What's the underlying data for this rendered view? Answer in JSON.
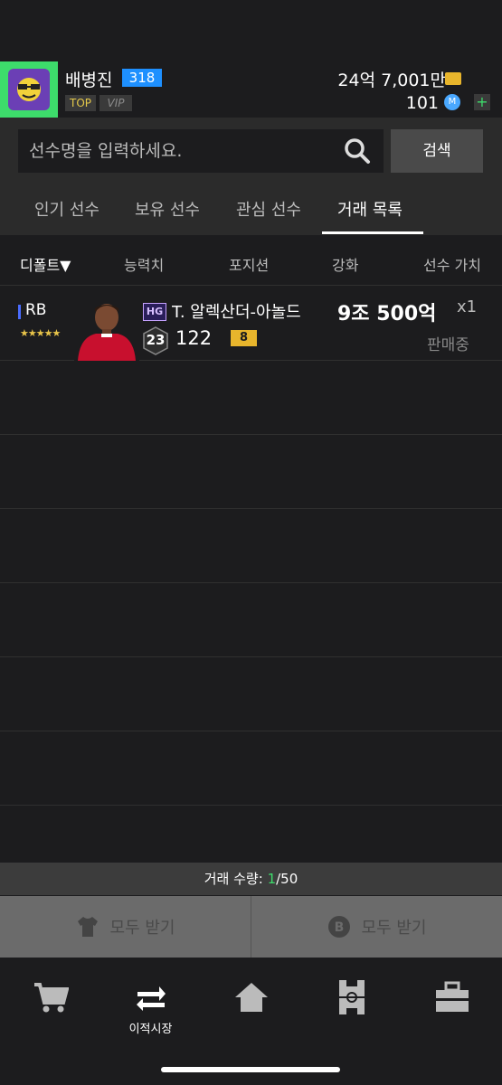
{
  "profile": {
    "username": "배병진",
    "level": "318",
    "top_badge": "TOP",
    "vip_badge": "VIP",
    "currency": "24억 7,001만",
    "points": "101"
  },
  "search": {
    "placeholder": "선수명을 입력하세요.",
    "button_label": "검색"
  },
  "tabs": [
    {
      "label": "인기 선수",
      "active": false
    },
    {
      "label": "보유 선수",
      "active": false
    },
    {
      "label": "관심 선수",
      "active": false
    },
    {
      "label": "거래 목록",
      "active": true
    }
  ],
  "columns": {
    "sort_label": "디폴트▼",
    "ability": "능력치",
    "position": "포지션",
    "enhance": "강화",
    "value": "선수 가치"
  },
  "listings": [
    {
      "position": "RB",
      "stars": "★★★★★",
      "hg_badge": "HG",
      "name": "T. 알렉산더-아놀드",
      "season": "23",
      "ovr": "122",
      "enhance": "8",
      "price": "9조 500억",
      "quantity": "x1",
      "status": "판매중"
    }
  ],
  "trade_count": {
    "label": "거래 수량:",
    "current": "1",
    "total": "/50"
  },
  "receive": {
    "left_label": "모두 받기",
    "right_label": "모두 받기"
  },
  "nav": {
    "transfer_label": "이적시장"
  },
  "colors": {
    "background": "#1c1c1e",
    "accent_green": "#3ddc6b",
    "level_blue": "#1e90ff",
    "gold": "#e8b52c"
  }
}
